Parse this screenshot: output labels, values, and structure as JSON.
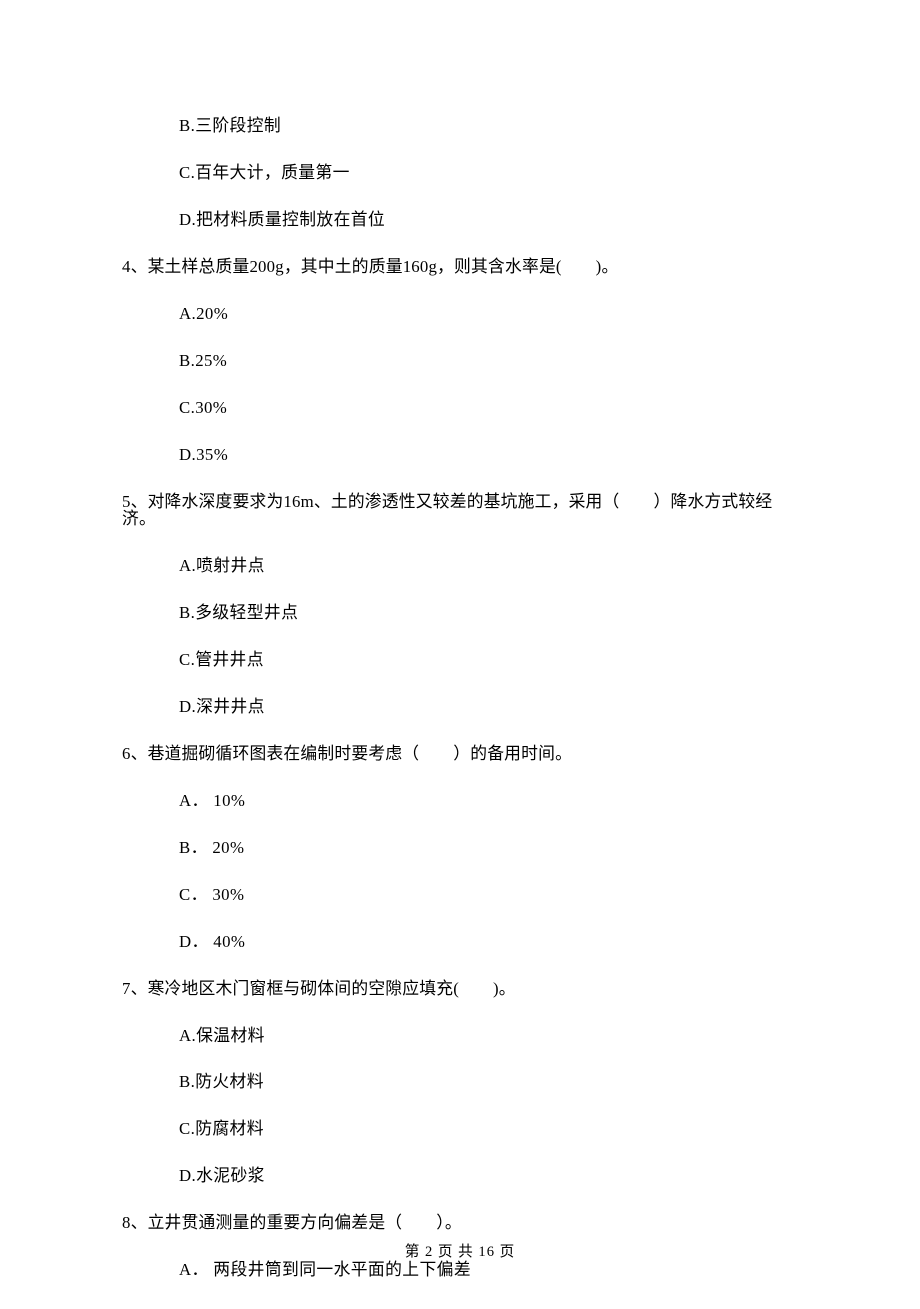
{
  "q3_options": {
    "b": "B.三阶段控制",
    "c": "C.百年大计，质量第一",
    "d": "D.把材料质量控制放在首位"
  },
  "q4": {
    "prompt": "4、某土样总质量200g，其中土的质量160g，则其含水率是(　　)。",
    "a": "A.20%",
    "b": "B.25%",
    "c": "C.30%",
    "d": "D.35%"
  },
  "q5": {
    "prompt": "5、对降水深度要求为16m、土的渗透性又较差的基坑施工，采用（　　）降水方式较经济。",
    "a": "A.喷射井点",
    "b": "B.多级轻型井点",
    "c": "C.管井井点",
    "d": "D.深井井点"
  },
  "q6": {
    "prompt": "6、巷道掘砌循环图表在编制时要考虑（　　）的备用时间。",
    "a": "A． 10%",
    "b": "B． 20%",
    "c": "C． 30%",
    "d": "D． 40%"
  },
  "q7": {
    "prompt": "7、寒冷地区木门窗框与砌体间的空隙应填充(　　)。",
    "a": "A.保温材料",
    "b": "B.防火材料",
    "c": "C.防腐材料",
    "d": "D.水泥砂浆"
  },
  "q8": {
    "prompt": "8、立井贯通测量的重要方向偏差是（　　）。",
    "a": "A． 两段井筒到同一水平面的上下偏差"
  },
  "footer": "第 2 页 共 16 页"
}
